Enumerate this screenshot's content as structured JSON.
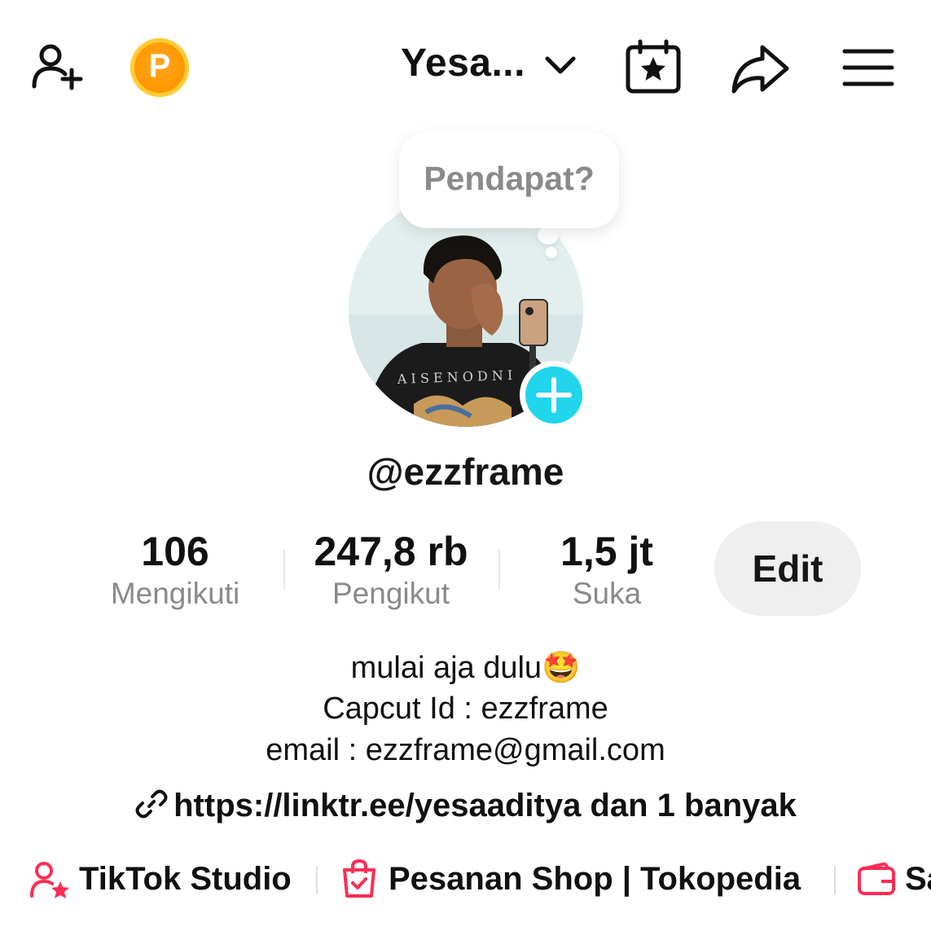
{
  "header": {
    "account_name": "Yesa...",
    "coin_letter": "P"
  },
  "profile": {
    "bubble_text": "Pendapat?",
    "username": "@ezzframe"
  },
  "stats": [
    {
      "value": "106",
      "label": "Mengikuti"
    },
    {
      "value": "247,8 rb",
      "label": "Pengikut"
    },
    {
      "value": "1,5 jt",
      "label": "Suka"
    }
  ],
  "edit_label": "Edit",
  "bio": {
    "line1": "mulai aja dulu",
    "line1_emoji": "🤩",
    "line2": "Capcut Id : ezzframe",
    "line3": "email : ezzframe@gmail.com"
  },
  "link": {
    "text": "https://linktr.ee/yesaaditya dan 1 banyak"
  },
  "tools": [
    {
      "label": "TikTok Studio"
    },
    {
      "label": "Pesanan Shop | Tokopedia"
    },
    {
      "label": "Sa"
    }
  ],
  "colors": {
    "accent_pink": "#fe2c55",
    "plus_cyan": "#20d5ec",
    "coin_orange": "#ff9800"
  }
}
